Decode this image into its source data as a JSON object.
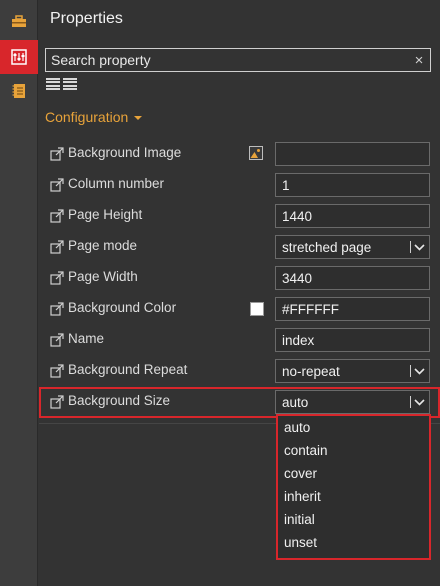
{
  "panel": {
    "title": "Properties"
  },
  "search": {
    "placeholder": "Search property",
    "clear_symbol": "×"
  },
  "section": {
    "label": "Configuration"
  },
  "properties": [
    {
      "label": "Background Image",
      "value": "",
      "control": "image-input"
    },
    {
      "label": "Column number",
      "value": "1",
      "control": "text"
    },
    {
      "label": "Page Height",
      "value": "1440",
      "control": "text"
    },
    {
      "label": "Page mode",
      "value": "stretched page",
      "control": "select"
    },
    {
      "label": "Page Width",
      "value": "3440",
      "control": "text"
    },
    {
      "label": "Background Color",
      "value": "#FFFFFF",
      "control": "color",
      "swatch": "#FFFFFF"
    },
    {
      "label": "Name",
      "value": "index",
      "control": "text"
    },
    {
      "label": "Background Repeat",
      "value": "no-repeat",
      "control": "select"
    },
    {
      "label": "Background Size",
      "value": "auto",
      "control": "select"
    }
  ],
  "dropdown": {
    "options": [
      "auto",
      "contain",
      "cover",
      "inherit",
      "initial",
      "unset"
    ]
  },
  "colors": {
    "accent": "#d8262b",
    "section": "#e8a33a",
    "background": "#333333"
  }
}
